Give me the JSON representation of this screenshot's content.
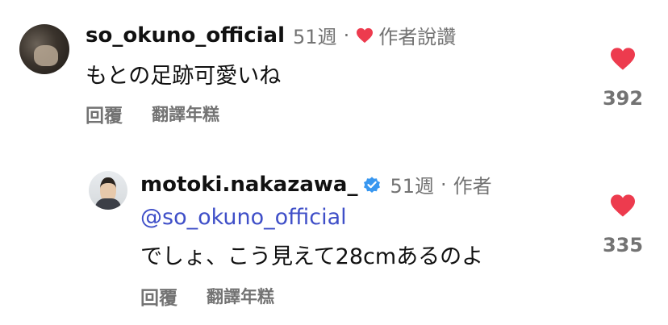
{
  "comments": [
    {
      "username": "so_okuno_official",
      "time": "51週",
      "separator": "·",
      "creator_liked_label": "作者說讚",
      "text": "もとの足跡可愛いね",
      "reply_label": "回覆",
      "translate_label": "翻譯年糕",
      "like_count": "392"
    }
  ],
  "replies": [
    {
      "username": "motoki.nakazawa_",
      "verified": true,
      "time": "51週",
      "separator": "·",
      "author_label": "作者",
      "mention": "@so_okuno_official",
      "text": "でしょ、こう見えて28cmあるのよ",
      "reply_label": "回覆",
      "translate_label": "翻譯年糕",
      "like_count": "335"
    }
  ],
  "colors": {
    "heart": "#ed3b4e",
    "verified": "#3897f0",
    "mention": "#3f4fc8",
    "secondary": "#737373"
  },
  "icons": [
    "heart-icon",
    "verified-badge-icon"
  ]
}
